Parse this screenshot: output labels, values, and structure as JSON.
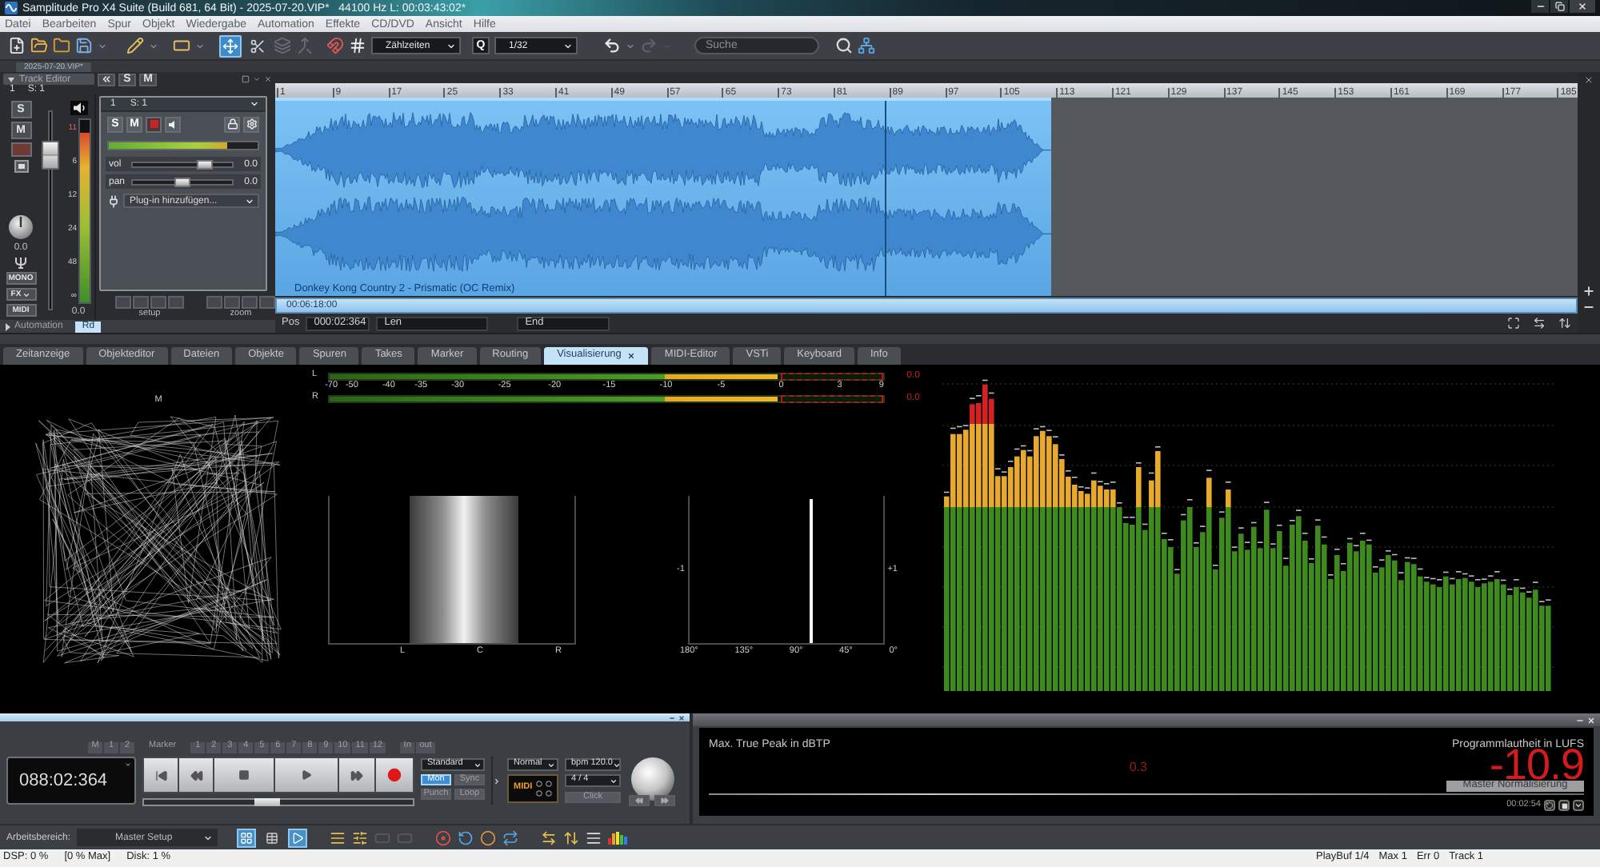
{
  "window": {
    "title": "Samplitude Pro X4 Suite (Build 681, 64 Bit) - 2025-07-20.VIP*   44100 Hz L: 00:03:43:02*"
  },
  "menu": [
    "Datei",
    "Bearbeiten",
    "Spur",
    "Objekt",
    "Wiedergabe",
    "Automation",
    "Effekte",
    "CD/DVD",
    "Ansicht",
    "Hilfe"
  ],
  "toolbar": {
    "tools": [
      {
        "kind": "move",
        "selected": true
      },
      {
        "kind": "split",
        "selected": false
      }
    ],
    "time_format": "Zählzeiten",
    "quantize_label": "Q",
    "quantize": "1/32",
    "redo_disabled": true,
    "search": {
      "placeholder": "Suche"
    }
  },
  "project_tabs": [
    {
      "label": "2025-07-20.VIP*",
      "selected": true
    }
  ],
  "track_editor": {
    "title": "Track Editor",
    "buttons": [
      "S",
      "M"
    ],
    "channel_number": "1",
    "channel_name": "S: 1"
  },
  "mixer_strip": {
    "buttons": [
      "S",
      "M"
    ],
    "pan_reading": "0.0",
    "fader": {
      "level": 0.78
    },
    "meter": {
      "level": 0.93,
      "scale": [
        "11",
        "6",
        "12",
        "24",
        "48",
        "∞"
      ],
      "reading": "0.0"
    },
    "bottom_buttons": [
      "MONO",
      "FX",
      "MIDI"
    ]
  },
  "track": {
    "number": "1",
    "name": "S: 1",
    "buttons": [
      "S",
      "M"
    ],
    "meter": {
      "level": 0.8
    },
    "sliders": [
      {
        "label": "vol",
        "value": "0.0",
        "level": 0.72
      },
      {
        "label": "pan",
        "value": "0.0",
        "level": 0.5
      }
    ],
    "plugin": "Plug-in hinzufügen...",
    "groups": [
      "setup",
      "zoom"
    ]
  },
  "automation": {
    "label": "Automation",
    "mode": "Rd"
  },
  "arrange": {
    "ruler": [
      "1",
      "9",
      "17",
      "25",
      "33",
      "41",
      "49",
      "57",
      "65",
      "73",
      "81",
      "89",
      "97",
      "105",
      "113",
      "121",
      "129",
      "137",
      "145",
      "153",
      "161",
      "169",
      "177",
      "185"
    ],
    "clip": {
      "name": "Donkey Kong Country 2 - Prismatic (OC Remix)"
    },
    "playhead": {
      "level": 0.786
    },
    "overview_time": "00:06:18:00",
    "position_label": "Pos",
    "position": "000:02:364",
    "length_label": "Len",
    "end_label": "End"
  },
  "tabs": [
    {
      "label": "Zeitanzeige",
      "selected": false
    },
    {
      "label": "Objekteditor",
      "selected": false
    },
    {
      "label": "Dateien",
      "selected": false
    },
    {
      "label": "Objekte",
      "selected": false
    },
    {
      "label": "Spuren",
      "selected": false
    },
    {
      "label": "Takes",
      "selected": false
    },
    {
      "label": "Marker",
      "selected": false
    },
    {
      "label": "Routing",
      "selected": false
    },
    {
      "label": "Visualisierung",
      "selected": true
    },
    {
      "label": "MIDI-Editor",
      "selected": false
    },
    {
      "label": "VSTi",
      "selected": false
    },
    {
      "label": "Keyboard",
      "selected": false
    },
    {
      "label": "Info",
      "selected": false
    }
  ],
  "visualization": {
    "goniometer": {
      "label": "M"
    },
    "level_meter": {
      "channels": [
        {
          "label": "L",
          "level": 0.81,
          "reading": "0.0"
        },
        {
          "label": "R",
          "level": 0.81,
          "reading": "0.0"
        }
      ],
      "scale": [
        "-70",
        "-50",
        "-40",
        "-35",
        "-30",
        "-25",
        "-20",
        "-15",
        "-10",
        "-5",
        "0",
        "3",
        "9"
      ]
    },
    "panorama": {
      "labels": [
        "L",
        "C",
        "R"
      ]
    },
    "correlation": {
      "min_label": "-1",
      "max_label": "+1",
      "scale": [
        "180°",
        "135°",
        "90°",
        "45°",
        "0°"
      ],
      "level": 0.63
    }
  },
  "transport": {
    "range_buttons": [
      "M",
      "1",
      "2"
    ],
    "marker_label": "Marker",
    "markers": [
      "1",
      "2",
      "3",
      "4",
      "5",
      "6",
      "7",
      "8",
      "9",
      "10",
      "11",
      "12"
    ],
    "in_label": "In",
    "out_label": "out",
    "time": "088:02:364",
    "position": {
      "level": 0.46
    },
    "mode": "Standard",
    "mode_buttons": [
      {
        "label": "Mon",
        "selected": true
      },
      {
        "label": "Sync",
        "selected": false
      },
      {
        "label": "Punch",
        "selected": false
      },
      {
        "label": "Loop",
        "selected": false
      }
    ],
    "play_mode": "Normal",
    "tempo": "bpm 120.0",
    "signature": "4 / 4",
    "click": "Click",
    "midi_label": "MIDI"
  },
  "loudness": {
    "true_peak_label": "Max. True Peak in dBTP",
    "true_peak": "0.3",
    "program_label": "Programmlautheit in LUFS",
    "program": "-10.9",
    "normalize_button": "Master Normalisierung",
    "elapsed": "00:02:54"
  },
  "workspace": {
    "label": "Arbeitsbereich:",
    "value": "Master Setup",
    "view_buttons": [
      {
        "kind": "arrange",
        "selected": true
      },
      {
        "kind": "table",
        "selected": false
      },
      {
        "kind": "transport",
        "selected": true
      }
    ]
  },
  "status_bar": {
    "left": [
      "DSP: 0 %",
      "[0 % Max]",
      "Disk: 1 %"
    ],
    "right": [
      "PlayBuf 1/4",
      "Max 1",
      "Err 0",
      "Track 1"
    ]
  }
}
